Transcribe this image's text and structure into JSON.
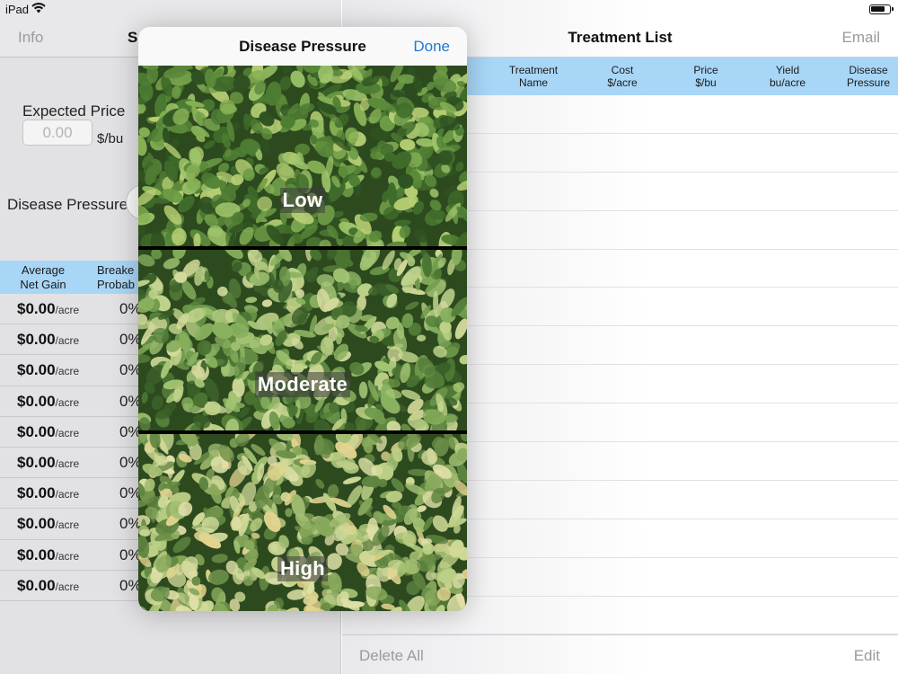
{
  "status_bar": {
    "device": "iPad"
  },
  "left_pane": {
    "nav": {
      "back_label": "Info",
      "title": "Sp"
    },
    "expected_price": {
      "label": "Expected Price",
      "placeholder": "0.00",
      "unit": "$/bu"
    },
    "disease_pressure": {
      "label": "Disease Pressure"
    },
    "results": {
      "headers": {
        "avg_net_gain": "Average\nNet Gain",
        "breakeven": "Breake\nProbab"
      },
      "rows": [
        {
          "gain": "$0.00",
          "unit": "/acre",
          "prob": "0%"
        },
        {
          "gain": "$0.00",
          "unit": "/acre",
          "prob": "0%"
        },
        {
          "gain": "$0.00",
          "unit": "/acre",
          "prob": "0%"
        },
        {
          "gain": "$0.00",
          "unit": "/acre",
          "prob": "0%"
        },
        {
          "gain": "$0.00",
          "unit": "/acre",
          "prob": "0%"
        },
        {
          "gain": "$0.00",
          "unit": "/acre",
          "prob": "0%"
        },
        {
          "gain": "$0.00",
          "unit": "/acre",
          "prob": "0%"
        },
        {
          "gain": "$0.00",
          "unit": "/acre",
          "prob": "0%"
        },
        {
          "gain": "$0.00",
          "unit": "/acre",
          "prob": "0%"
        },
        {
          "gain": "$0.00",
          "unit": "/acre",
          "prob": "0%"
        }
      ]
    }
  },
  "right_pane": {
    "nav": {
      "title": "Treatment List",
      "email_label": "Email"
    },
    "table_headers": {
      "treatment_name": "Treatment\nName",
      "cost": "Cost\n$/acre",
      "price": "Price\n$/bu",
      "yield": "Yield\nbu/acre",
      "disease_pressure": "Disease\nPressure"
    },
    "toolbar": {
      "delete_all_label": "Delete All",
      "edit_label": "Edit"
    }
  },
  "popover": {
    "title": "Disease Pressure",
    "done_label": "Done",
    "options": [
      {
        "label": "Low"
      },
      {
        "label": "Moderate"
      },
      {
        "label": "High"
      }
    ]
  },
  "colors": {
    "header_blue": "#a8d6f7",
    "accent_blue": "#1e7ad6",
    "disabled_gray": "#9a9aa0"
  },
  "icons": [
    "wifi-icon",
    "battery-icon"
  ]
}
